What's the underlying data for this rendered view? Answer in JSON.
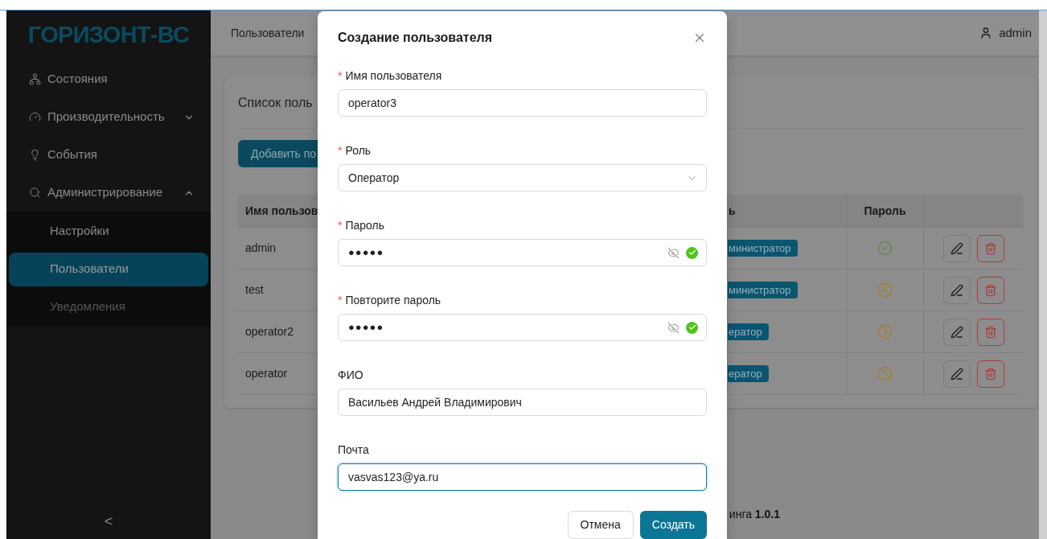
{
  "sidebar": {
    "logo": "ГОРИЗОНТ-ВС",
    "items": [
      {
        "label": "Состояния"
      },
      {
        "label": "Производительность",
        "expanded": false
      },
      {
        "label": "События"
      },
      {
        "label": "Администрирование",
        "expanded": true,
        "children": [
          {
            "label": "Настройки",
            "selected": false,
            "disabled": false
          },
          {
            "label": "Пользователи",
            "selected": true,
            "disabled": false
          },
          {
            "label": "Уведомления",
            "selected": false,
            "disabled": true
          }
        ]
      }
    ],
    "collapse": "<"
  },
  "header": {
    "breadcrumb": "Пользователи",
    "user": "admin"
  },
  "card": {
    "title": "Список поль",
    "add_button": "Добавить по",
    "table": {
      "columns": [
        "Имя пользов",
        "ь",
        "Пароль"
      ],
      "rows": [
        {
          "name": "admin",
          "role": "министратор",
          "password_confirmed": true
        },
        {
          "name": "test",
          "role": "министратор",
          "password_confirmed": false
        },
        {
          "name": "operator2",
          "role": "ератор",
          "password_confirmed": false
        },
        {
          "name": "operator",
          "role": "ератор",
          "password_confirmed": false
        }
      ]
    }
  },
  "footer": "инга **1.0.1**",
  "modal": {
    "title": "Создание пользователя",
    "fields": [
      {
        "label": "Имя пользователя",
        "required_mark": "*",
        "kind": "text",
        "value": "operator3",
        "valid": false,
        "focused": false
      },
      {
        "label": "Роль",
        "required_mark": "*",
        "kind": "select",
        "value": "Оператор",
        "valid": false,
        "focused": false
      },
      {
        "label": "Пароль",
        "required_mark": "*",
        "kind": "password",
        "value": "●●●●●",
        "valid": true,
        "focused": false
      },
      {
        "label": "Повторите пароль",
        "required_mark": "*",
        "kind": "password",
        "value": "●●●●●",
        "valid": true,
        "focused": false
      },
      {
        "label": "ФИО",
        "kind": "text",
        "value": "Васильев Андрей Владимирович",
        "valid": false,
        "focused": false
      },
      {
        "label": "Почта",
        "kind": "text",
        "value": "vasvas123@ya.ru",
        "valid": false,
        "focused": true
      }
    ],
    "buttons": [
      {
        "label": "Отмена",
        "kind": "secondary"
      },
      {
        "label": "Создать",
        "kind": "primary"
      }
    ]
  }
}
